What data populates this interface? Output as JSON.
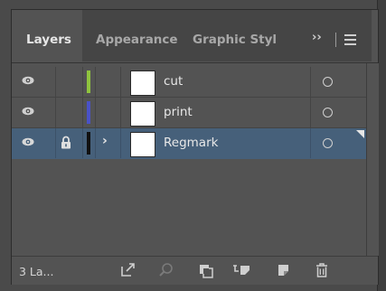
{
  "tabs": [
    {
      "label": "Layers"
    },
    {
      "label": "Appearance"
    },
    {
      "label": "Graphic Styl"
    }
  ],
  "tab_overflow": "››",
  "layers": [
    {
      "name": "cut",
      "color": "#8fc43e",
      "visible": true,
      "locked": false,
      "selected": false,
      "expandable": false
    },
    {
      "name": "print",
      "color": "#4a52c8",
      "visible": true,
      "locked": false,
      "selected": false,
      "expandable": false
    },
    {
      "name": "Regmark",
      "color": "#111111",
      "visible": true,
      "locked": true,
      "selected": true,
      "expandable": true
    }
  ],
  "footer": {
    "layer_count": "3 La..."
  },
  "colors": {
    "panel_bg": "#535353",
    "selected_row": "#46607a"
  }
}
